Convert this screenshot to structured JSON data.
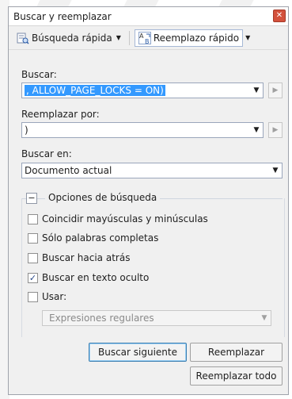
{
  "window": {
    "title": "Buscar y reemplazar"
  },
  "toolbar": {
    "quick_find_label": "Búsqueda rápida",
    "quick_replace_label": "Reemplazo rápido"
  },
  "find": {
    "label": "Buscar:",
    "value": ", ALLOW_PAGE_LOCKS  = ON)"
  },
  "replace": {
    "label": "Reemplazar por:",
    "value": ")"
  },
  "look_in": {
    "label": "Buscar en:",
    "value": "Documento actual"
  },
  "options": {
    "title": "Opciones de búsqueda",
    "toggle": "−",
    "match_case": {
      "label": "Coincidir mayúsculas y minúsculas",
      "checked": false
    },
    "whole_word": {
      "label": "Sólo palabras completas",
      "checked": false
    },
    "search_up": {
      "label": "Buscar hacia atrás",
      "checked": false
    },
    "search_hidden": {
      "label": "Buscar en texto oculto",
      "checked": true,
      "mark": "✓"
    },
    "use": {
      "label": "Usar:",
      "checked": false
    },
    "use_type": "Expresiones regulares"
  },
  "buttons": {
    "find_next": "Buscar siguiente",
    "replace": "Reemplazar",
    "replace_all": "Reemplazar todo"
  },
  "colors": {
    "accent": "#3399ff",
    "close": "#d3513c"
  }
}
